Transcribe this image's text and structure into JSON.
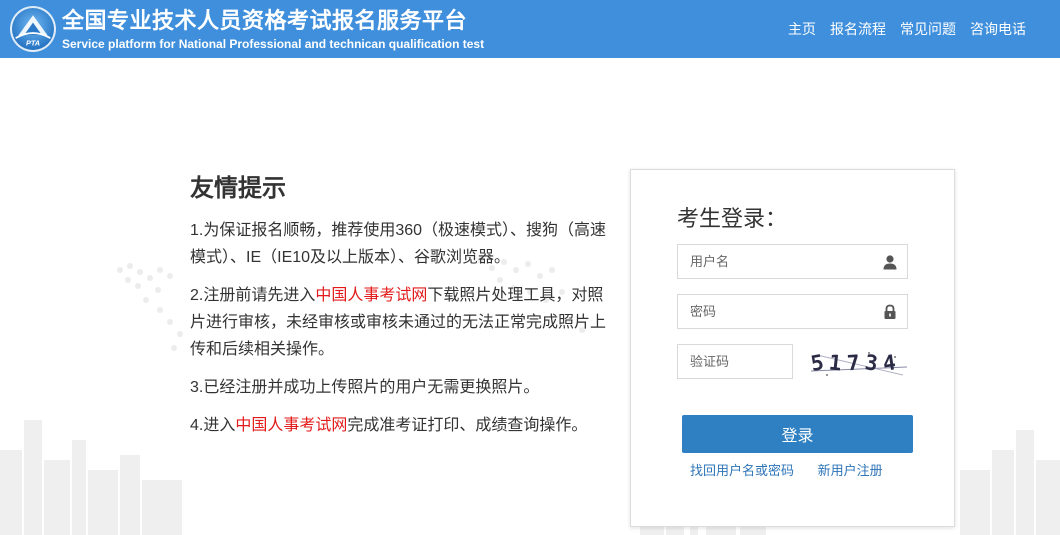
{
  "header": {
    "logo_text": "PTA",
    "title": "全国专业技术人员资格考试报名服务平台",
    "subtitle": "Service platform for National Professional and technican qualification test",
    "nav": [
      {
        "label": "主页"
      },
      {
        "label": "报名流程"
      },
      {
        "label": "常见问题"
      },
      {
        "label": "咨询电话"
      }
    ],
    "color": "#3f8fdc"
  },
  "tips": {
    "title": "友情提示",
    "items": [
      {
        "text": "1.为保证报名顺畅，推荐使用360（极速模式）、搜狗（高速模式）、IE（IE10及以上版本）、谷歌浏览器。"
      },
      {
        "before": "2.注册前请先进入",
        "link": "中国人事考试网",
        "after": "下载照片处理工具，对照片进行审核，未经审核或审核未通过的无法正常完成照片上传和后续相关操作。"
      },
      {
        "text": "3.已经注册并成功上传照片的用户无需更换照片。"
      },
      {
        "before": "4.进入",
        "link": "中国人事考试网",
        "after": "完成准考证打印、成绩查询操作。"
      }
    ],
    "link_color": "#e31b1b"
  },
  "login": {
    "title": "考生登录：",
    "username_placeholder": "用户名",
    "password_placeholder": "密码",
    "captcha_placeholder": "验证码",
    "captcha_chars": [
      "5",
      "1",
      "7",
      "3",
      "4"
    ],
    "submit_label": "登录",
    "forgot_label": "找回用户名或密码",
    "register_label": "新用户注册",
    "button_color": "#2f80c3"
  }
}
